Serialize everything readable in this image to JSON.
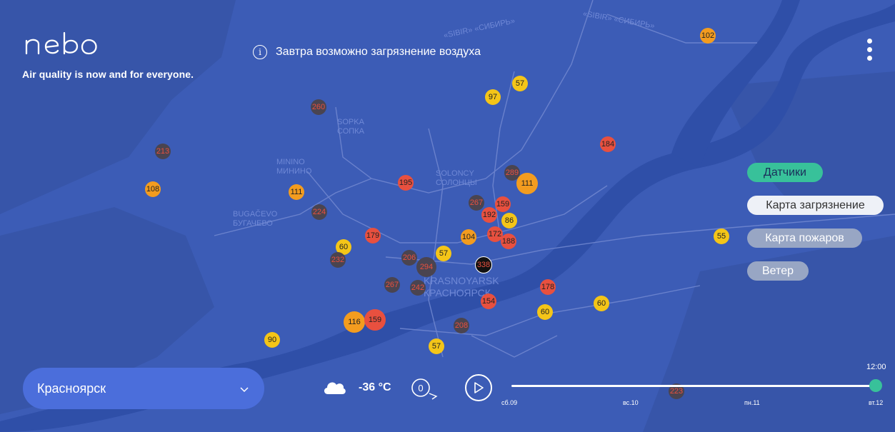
{
  "header": {
    "tagline": "Air quality is now and for everyone.",
    "notice": "Завтра возможно загрязнение воздуха"
  },
  "map": {
    "labels": [
      {
        "text": "«SIBIR» «СИБИРЬ»"
      },
      {
        "text": "«SIBIR» «СИБИРЬ»"
      },
      {
        "text": "SOLONCY"
      },
      {
        "text": "СОЛОНЦЫ"
      },
      {
        "text": "SOPKA"
      },
      {
        "text": "СОПКА"
      },
      {
        "text": "MININO"
      },
      {
        "text": "МИНИНО"
      },
      {
        "text": "BUGAČEVO"
      },
      {
        "text": "БУГАЧЕВО"
      },
      {
        "text": "KRASNOYARSK"
      },
      {
        "text": "КРАСНОЯРСК"
      }
    ],
    "markers": [
      {
        "value": "102",
        "level": "orange"
      },
      {
        "value": "57",
        "level": "yellow"
      },
      {
        "value": "97",
        "level": "yellow"
      },
      {
        "value": "260",
        "level": "dark"
      },
      {
        "value": "213",
        "level": "dark"
      },
      {
        "value": "108",
        "level": "orange"
      },
      {
        "value": "111",
        "level": "orange"
      },
      {
        "value": "224",
        "level": "dark"
      },
      {
        "value": "195",
        "level": "red"
      },
      {
        "value": "289",
        "level": "dark"
      },
      {
        "value": "111",
        "level": "orange"
      },
      {
        "value": "184",
        "level": "red"
      },
      {
        "value": "267",
        "level": "dark"
      },
      {
        "value": "159",
        "level": "red"
      },
      {
        "value": "192",
        "level": "red"
      },
      {
        "value": "86",
        "level": "yellow"
      },
      {
        "value": "104",
        "level": "orange"
      },
      {
        "value": "172",
        "level": "red"
      },
      {
        "value": "188",
        "level": "red"
      },
      {
        "value": "179",
        "level": "red"
      },
      {
        "value": "60",
        "level": "yellow"
      },
      {
        "value": "232",
        "level": "dark"
      },
      {
        "value": "57",
        "level": "yellow"
      },
      {
        "value": "206",
        "level": "dark"
      },
      {
        "value": "294",
        "level": "dark"
      },
      {
        "value": "338",
        "level": "black"
      },
      {
        "value": "267",
        "level": "dark"
      },
      {
        "value": "242",
        "level": "dark"
      },
      {
        "value": "178",
        "level": "red"
      },
      {
        "value": "154",
        "level": "red"
      },
      {
        "value": "60",
        "level": "yellow"
      },
      {
        "value": "60",
        "level": "yellow"
      },
      {
        "value": "55",
        "level": "yellow"
      },
      {
        "value": "116",
        "level": "orange"
      },
      {
        "value": "159",
        "level": "red"
      },
      {
        "value": "208",
        "level": "dark"
      },
      {
        "value": "90",
        "level": "yellow"
      },
      {
        "value": "57",
        "level": "yellow"
      },
      {
        "value": "223",
        "level": "dark"
      }
    ],
    "colors": {
      "yellow": "#f4c518",
      "orange": "#f39c1f",
      "red": "#e8503f",
      "dark": "#4a4450",
      "black": "#111111",
      "water": "#2f4fa8",
      "land": "#3c5cb6"
    }
  },
  "layers": {
    "sensors": "Датчики",
    "pollution": "Карта загрязнение",
    "fires": "Карта пожаров",
    "wind": "Ветер"
  },
  "city": {
    "name": "Красноярск"
  },
  "weather": {
    "icon": "cloud-icon",
    "temperature": "-36 °C",
    "wind_value": "0"
  },
  "timeline": {
    "time": "12:00",
    "days": [
      "сб.09",
      "вс.10",
      "пн.11",
      "вт.12"
    ],
    "progress": 1.0
  },
  "accent": "#38c19a"
}
